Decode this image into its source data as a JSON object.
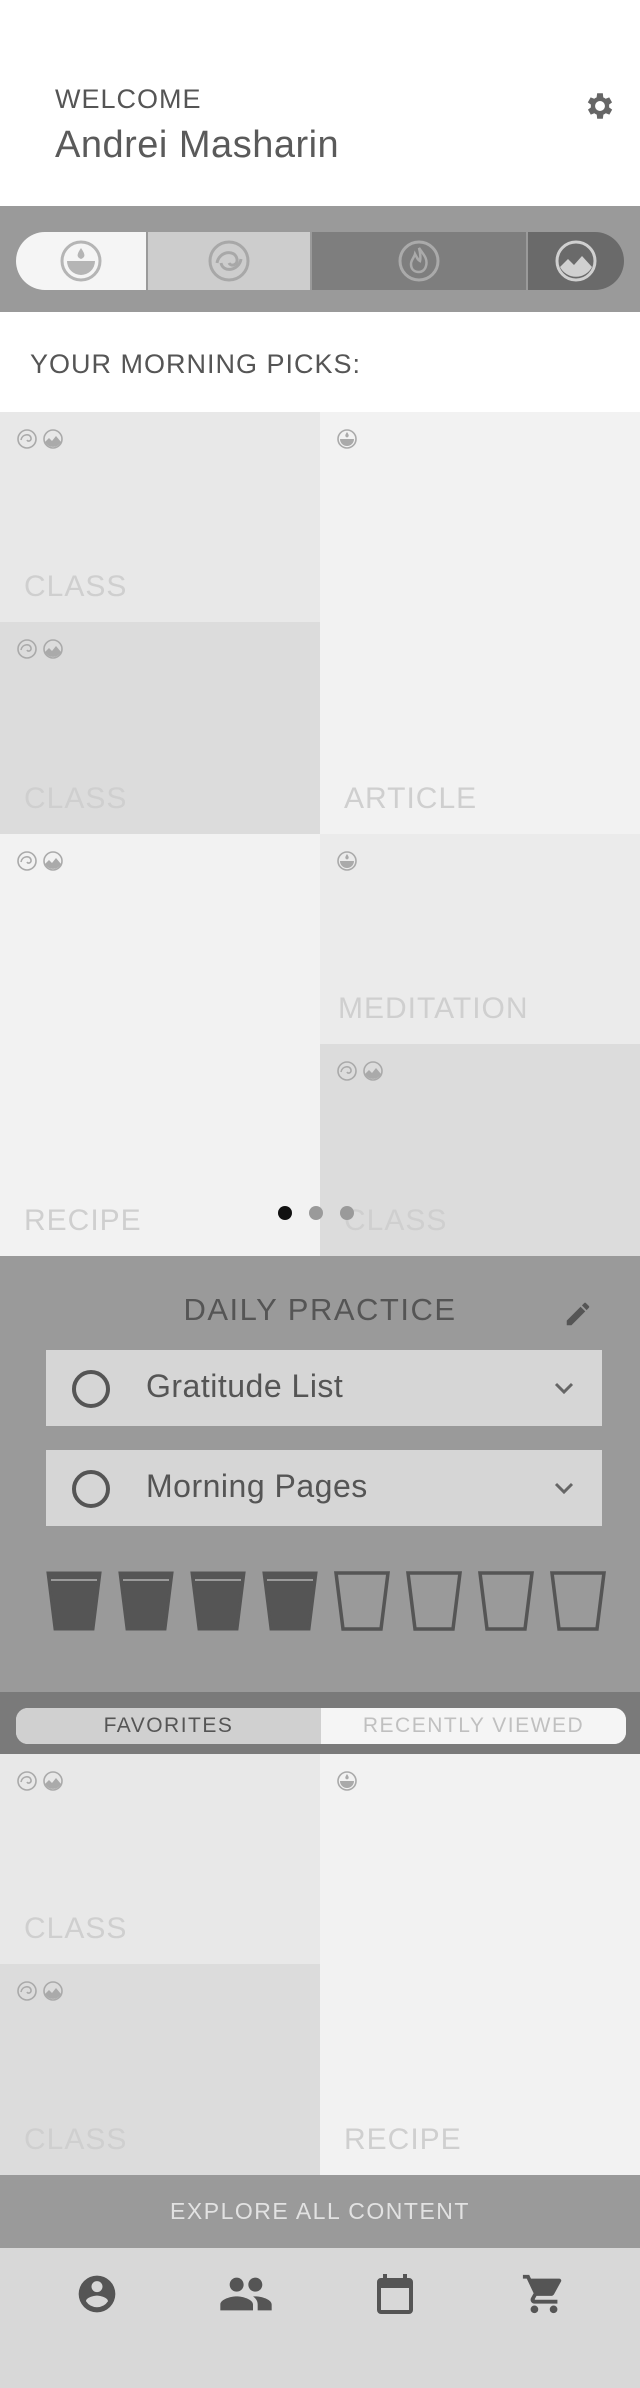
{
  "header": {
    "welcome_label": "WELCOME",
    "user_name": "Andrei Masharin",
    "settings_icon": "gear-icon"
  },
  "element_filter": {
    "segments": [
      {
        "name": "water",
        "icon": "water-drop-icon",
        "state": "selected"
      },
      {
        "name": "air",
        "icon": "air-swirl-icon",
        "state": "light"
      },
      {
        "name": "fire",
        "icon": "fire-icon",
        "state": "dark"
      },
      {
        "name": "earth",
        "icon": "earth-icon",
        "state": "darkest"
      }
    ]
  },
  "picks": {
    "title": "YOUR MORNING PICKS:",
    "cards": [
      {
        "label": "CLASS"
      },
      {
        "label": "CLASS"
      },
      {
        "label": "ARTICLE"
      },
      {
        "label": "RECIPE"
      },
      {
        "label": "MEDITATION"
      },
      {
        "label": "CLASS"
      }
    ],
    "carousel_pages": 3,
    "carousel_active": 1
  },
  "daily_practice": {
    "title": "DAILY PRACTICE",
    "items": [
      {
        "label": "Gratitude List"
      },
      {
        "label": "Morning Pages"
      }
    ],
    "water_cups_filled": 4,
    "water_cups_total": 8
  },
  "tabs": {
    "favorites": "FAVORITES",
    "recently_viewed": "RECENTLY VIEWED",
    "active": "favorites"
  },
  "favorites": {
    "cards": [
      {
        "label": "CLASS"
      },
      {
        "label": "CLASS"
      },
      {
        "label": "RECIPE"
      }
    ]
  },
  "explore_label": "EXPLORE ALL CONTENT",
  "bottom_nav": [
    {
      "name": "profile",
      "icon": "account-circle-icon"
    },
    {
      "name": "community",
      "icon": "people-icon"
    },
    {
      "name": "calendar",
      "icon": "calendar-icon"
    },
    {
      "name": "shop",
      "icon": "cart-icon"
    }
  ],
  "colors": {
    "band_gray": "#9a9a9a",
    "text_gray": "#555555",
    "card_label": "#cfcfcf"
  }
}
